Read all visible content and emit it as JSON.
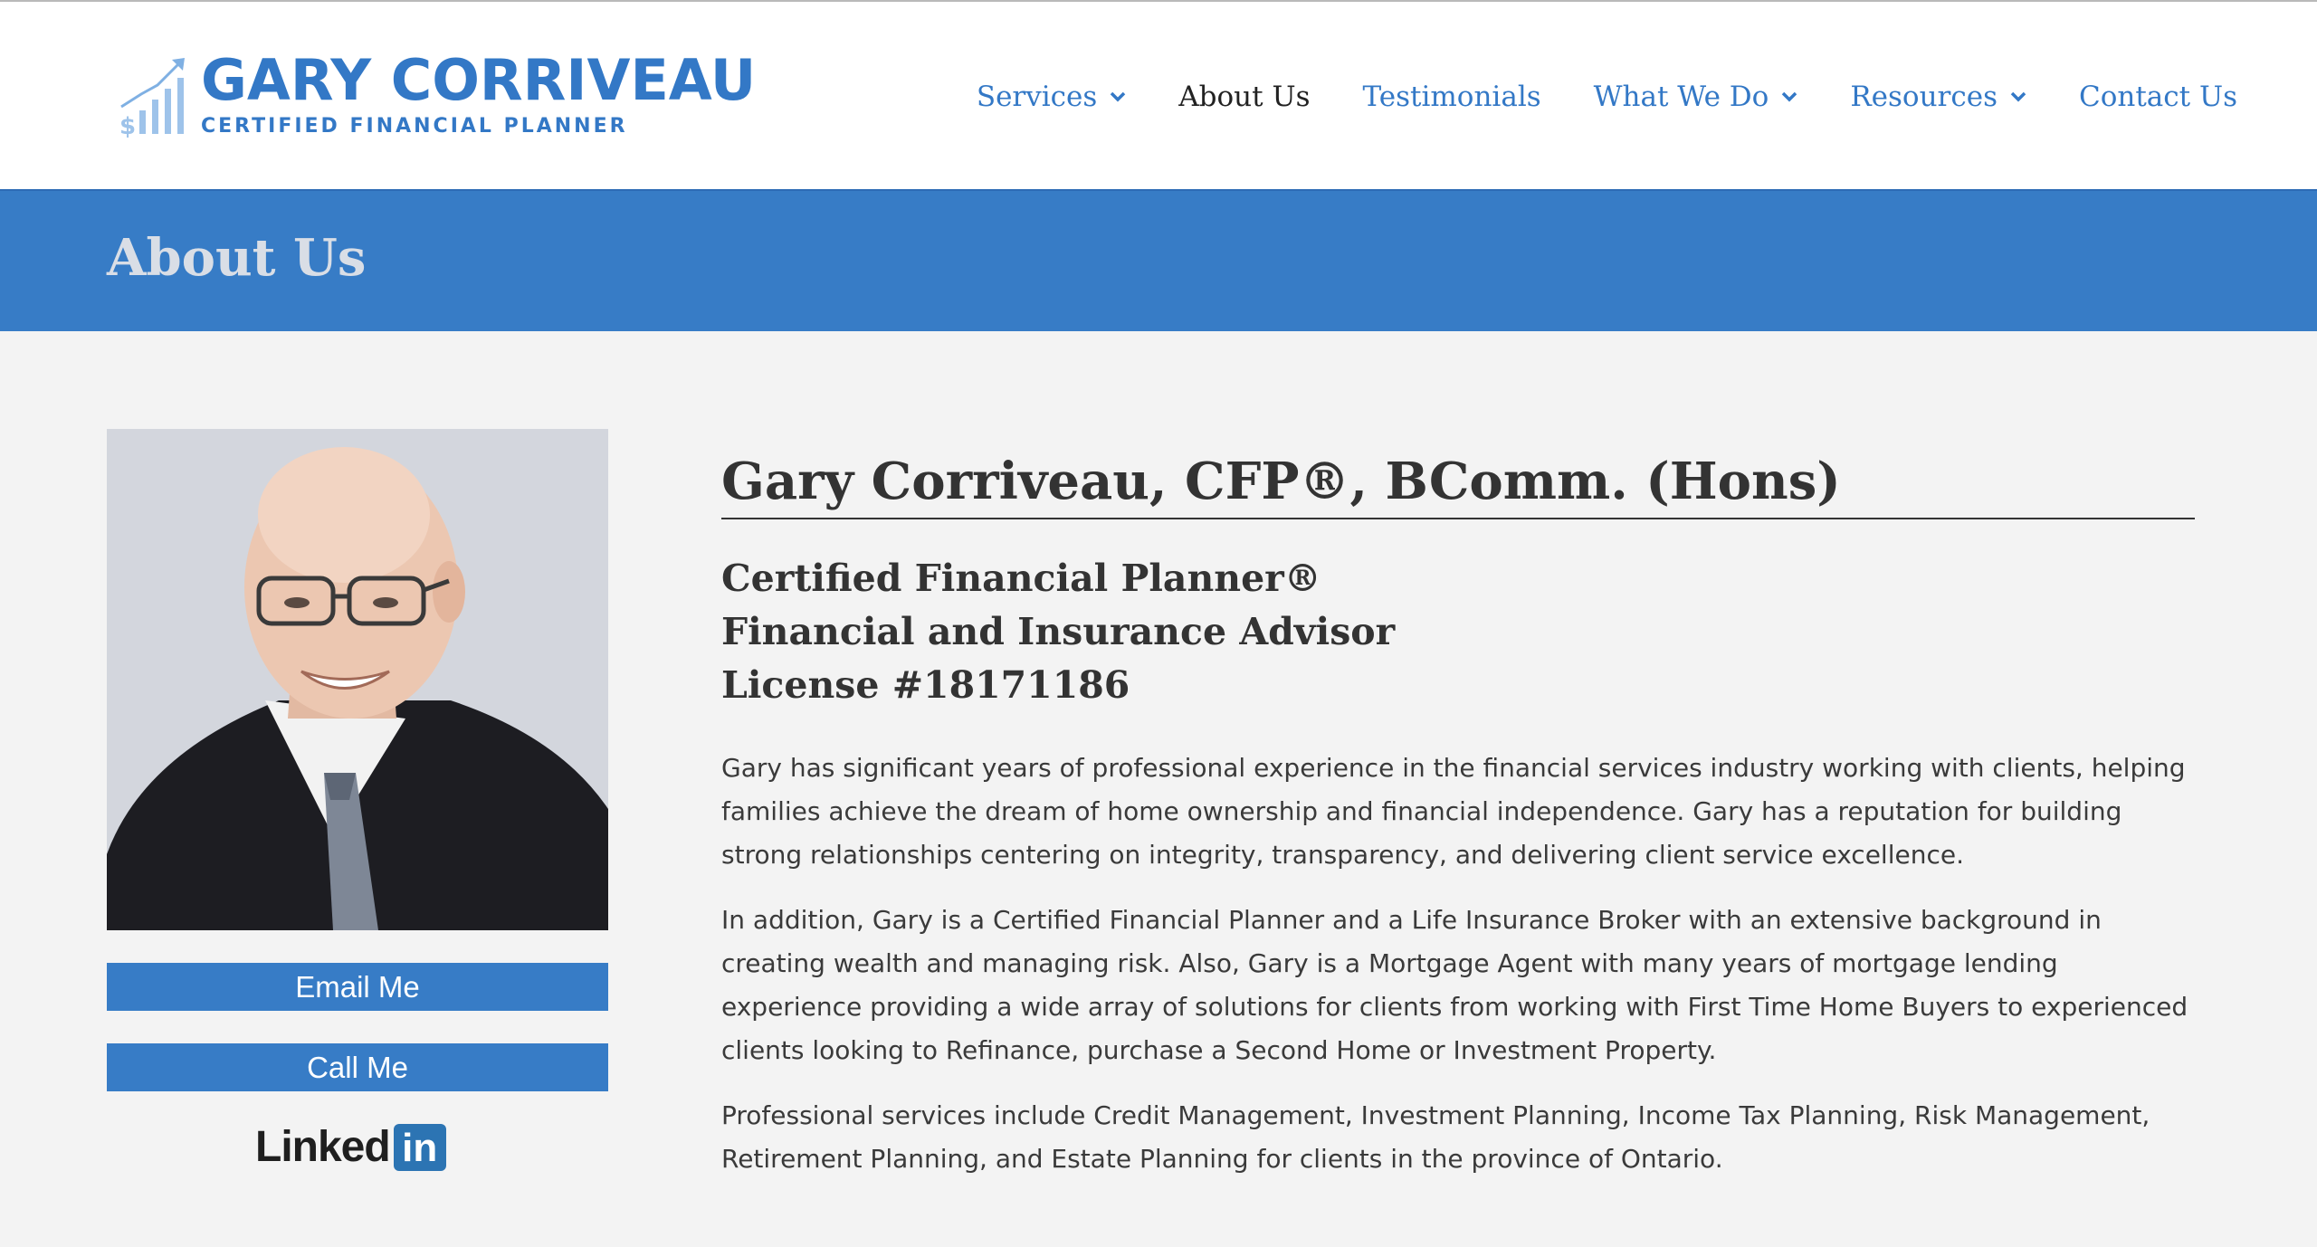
{
  "header": {
    "logo_title": "GARY CORRIVEAU",
    "logo_subtitle": "CERTIFIED FINANCIAL PLANNER",
    "brand_color": "#3378c6"
  },
  "nav": {
    "items": [
      {
        "label": "Services",
        "dropdown": true,
        "active": false
      },
      {
        "label": "About Us",
        "dropdown": false,
        "active": true
      },
      {
        "label": "Testimonials",
        "dropdown": false,
        "active": false
      },
      {
        "label": "What We Do",
        "dropdown": true,
        "active": false
      },
      {
        "label": "Resources",
        "dropdown": true,
        "active": false
      },
      {
        "label": "Contact Us",
        "dropdown": false,
        "active": false
      }
    ]
  },
  "banner": {
    "title": "About Us",
    "color": "#377cc6"
  },
  "sidebar": {
    "email_label": "Email Me",
    "call_label": "Call Me",
    "linkedin_text": "Linked",
    "linkedin_box": "in"
  },
  "main": {
    "name": "Gary Corriveau, CFP®, BComm. (Hons)",
    "roles": [
      "Certified Financial Planner®",
      "Financial and Insurance Advisor",
      "License #18171186"
    ],
    "paragraphs": [
      "Gary has significant years of professional experience in the financial services industry working with clients, helping families achieve the dream of home ownership and financial independence. Gary has a reputation for building strong relationships centering on integrity, transparency, and delivering client service excellence.",
      "In addition, Gary is a Certified Financial Planner and a Life Insurance Broker with an extensive background in creating wealth and managing risk. Also, Gary is a Mortgage Agent with many years of mortgage lending experience providing a wide array of solutions for clients from working with First Time Home Buyers to experienced clients looking to Refinance, purchase a Second Home or Investment Property.",
      "Professional services include Credit Management, Investment Planning, Income Tax Planning, Risk Management, Retirement Planning, and Estate Planning for clients in the province of Ontario."
    ]
  }
}
